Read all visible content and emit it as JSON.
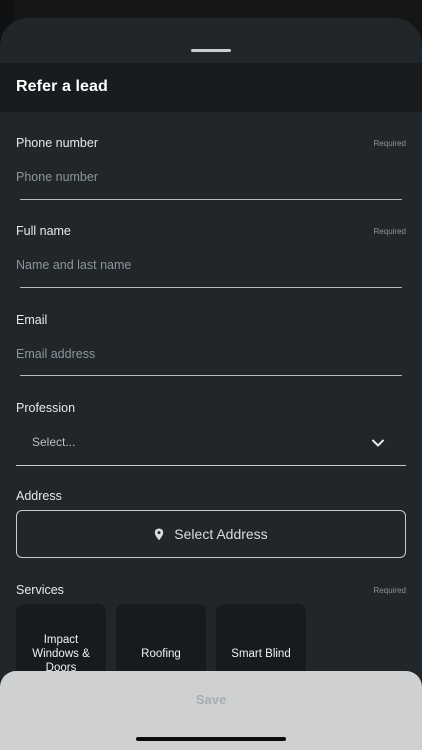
{
  "sheet": {
    "title": "Refer a lead"
  },
  "fields": {
    "phone": {
      "label": "Phone number",
      "required": "Required",
      "placeholder": "Phone number",
      "value": ""
    },
    "full_name": {
      "label": "Full name",
      "required": "Required",
      "placeholder": "Name and last name",
      "value": ""
    },
    "email": {
      "label": "Email",
      "placeholder": "Email address",
      "value": ""
    },
    "profession": {
      "label": "Profession",
      "selected": "Select...",
      "icon": "chevron-down-icon"
    },
    "address": {
      "label": "Address",
      "button_label": "Select Address",
      "icon": "map-pin-icon"
    }
  },
  "services": {
    "label": "Services",
    "required": "Required",
    "items": [
      {
        "label": "Impact Windows & Doors"
      },
      {
        "label": "Roofing"
      },
      {
        "label": "Smart Blind"
      }
    ]
  },
  "footer": {
    "save_label": "Save"
  },
  "colors": {
    "sheet": "#202629",
    "header": "#181c1e",
    "card": "#171b1d",
    "footer": "#cfd0d1"
  }
}
